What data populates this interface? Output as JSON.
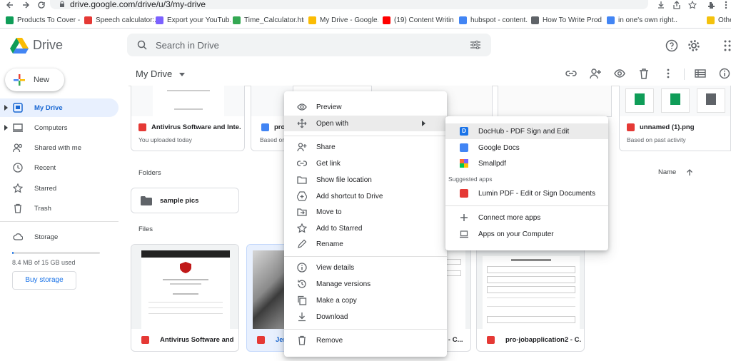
{
  "browser": {
    "url": "drive.google.com/drive/u/3/my-drive",
    "bookmarks": [
      {
        "label": "Products To Cover -...",
        "color": "#0f9d58"
      },
      {
        "label": "Speech calculator:...",
        "color": "#e53935"
      },
      {
        "label": "Export your YouTub...",
        "color": "#7b61ff"
      },
      {
        "label": "Time_Calculator.html",
        "color": "#34a853"
      },
      {
        "label": "My Drive - Google...",
        "color": "#fbbc04"
      },
      {
        "label": "(19) Content Writin...",
        "color": "#ff0000"
      },
      {
        "label": "hubspot - content...",
        "color": "#4285f4"
      },
      {
        "label": "How To Write Prod...",
        "color": "#5f6368"
      },
      {
        "label": "in one's own right...",
        "color": "#4285f4"
      },
      {
        "label": "Othe",
        "color": "#f4c20d"
      }
    ]
  },
  "app": {
    "name": "Drive"
  },
  "search": {
    "placeholder": "Search in Drive"
  },
  "sidebar": {
    "new_label": "New",
    "items": [
      {
        "label": "My Drive",
        "icon": "my-drive-icon",
        "active": true
      },
      {
        "label": "Computers",
        "icon": "computer-icon"
      },
      {
        "label": "Shared with me",
        "icon": "people-icon"
      },
      {
        "label": "Recent",
        "icon": "clock-icon"
      },
      {
        "label": "Starred",
        "icon": "star-icon"
      },
      {
        "label": "Trash",
        "icon": "trash-icon"
      }
    ],
    "storage": {
      "label": "Storage",
      "used_text": "8.4 MB of 15 GB used",
      "used_fraction": 0.0006,
      "buy_label": "Buy storage"
    }
  },
  "main": {
    "title": "My Drive",
    "sections": {
      "folders": "Folders",
      "files": "Files",
      "sort": "Name"
    },
    "suggested": [
      {
        "name": "Antivirus Software and Inte...",
        "sub": "You uploaded today",
        "type": "pdf"
      },
      {
        "name": "pro-",
        "sub": "Based on",
        "type": "doc"
      },
      {
        "name": "unnamed (1).png",
        "sub": "Based on past activity",
        "type": "img"
      }
    ],
    "folders": [
      {
        "name": "sample pics"
      }
    ],
    "files": [
      {
        "name": "Antivirus Software and ...",
        "type": "pdf"
      },
      {
        "name": "Jer",
        "type": "pdf"
      },
      {
        "name": "2 - C...",
        "type": "pdf"
      },
      {
        "name": "pro-jobapplication2 - C...",
        "type": "pdf"
      }
    ]
  },
  "context_menu": {
    "items": [
      {
        "label": "Preview",
        "icon": "eye-icon"
      },
      {
        "label": "Open with",
        "icon": "move-arrows-icon",
        "submenu": true
      },
      {
        "label": "Share",
        "icon": "person-add-icon"
      },
      {
        "label": "Get link",
        "icon": "link-icon"
      },
      {
        "label": "Show file location",
        "icon": "folder-icon"
      },
      {
        "label": "Add shortcut to Drive",
        "icon": "shortcut-icon"
      },
      {
        "label": "Move to",
        "icon": "move-to-icon"
      },
      {
        "label": "Add to Starred",
        "icon": "star-icon"
      },
      {
        "label": "Rename",
        "icon": "pencil-icon"
      },
      {
        "label": "View details",
        "icon": "info-icon"
      },
      {
        "label": "Manage versions",
        "icon": "history-icon"
      },
      {
        "label": "Make a copy",
        "icon": "copy-icon"
      },
      {
        "label": "Download",
        "icon": "download-icon"
      },
      {
        "label": "Remove",
        "icon": "trash-icon"
      }
    ]
  },
  "submenu": {
    "items": [
      {
        "label": "DocHub - PDF Sign and Edit",
        "color": "#1a73e8"
      },
      {
        "label": "Google Docs",
        "color": "#4285f4"
      },
      {
        "label": "Smallpdf",
        "color": "#ff6b35"
      }
    ],
    "suggested_header": "Suggested apps",
    "suggested": [
      {
        "label": "Lumin PDF - Edit or Sign Documents",
        "color": "#e53935"
      }
    ],
    "extras": [
      {
        "label": "Connect more apps",
        "icon": "plus-icon"
      },
      {
        "label": "Apps on your Computer",
        "icon": "laptop-icon"
      }
    ]
  }
}
